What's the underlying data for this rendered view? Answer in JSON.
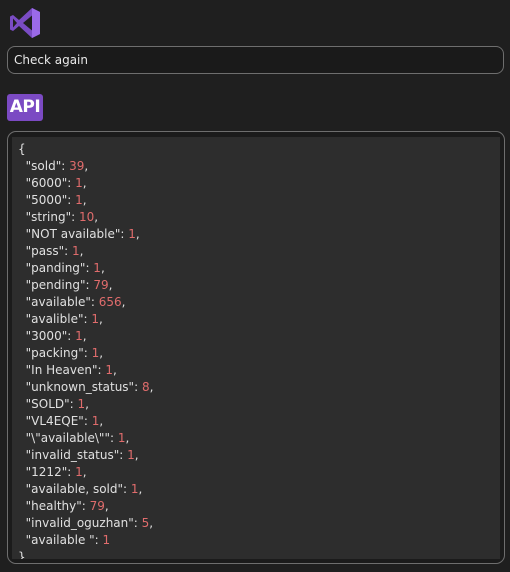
{
  "app": {
    "logo_icon": "visual-studio-logo-icon",
    "logo_color": "#8b5cd6"
  },
  "search": {
    "value": "Check again"
  },
  "api_badge": {
    "label": "API",
    "color": "#7b4ac3"
  },
  "json_view": {
    "open_brace": "{",
    "close_brace": "}",
    "entries": [
      {
        "key": "\"sold\"",
        "value": "39"
      },
      {
        "key": "\"6000\"",
        "value": "1"
      },
      {
        "key": "\"5000\"",
        "value": "1"
      },
      {
        "key": "\"string\"",
        "value": "10"
      },
      {
        "key": "\"NOT available\"",
        "value": "1"
      },
      {
        "key": "\"pass\"",
        "value": "1"
      },
      {
        "key": "\"panding\"",
        "value": "1"
      },
      {
        "key": "\"pending\"",
        "value": "79"
      },
      {
        "key": "\"available\"",
        "value": "656"
      },
      {
        "key": "\"avalible\"",
        "value": "1"
      },
      {
        "key": "\"3000\"",
        "value": "1"
      },
      {
        "key": "\"packing\"",
        "value": "1"
      },
      {
        "key": "\"In Heaven\"",
        "value": "1"
      },
      {
        "key": "\"unknown_status\"",
        "value": "8"
      },
      {
        "key": "\"SOLD\"",
        "value": "1"
      },
      {
        "key": "\"VL4EQE\"",
        "value": "1"
      },
      {
        "key": "\"\\\"available\\\"\"",
        "value": "1"
      },
      {
        "key": "\"invalid_status\"",
        "value": "1"
      },
      {
        "key": "\"1212\"",
        "value": "1"
      },
      {
        "key": "\"available, sold\"",
        "value": "1"
      },
      {
        "key": "\"healthy\"",
        "value": "79"
      },
      {
        "key": "\"invalid_oguzhan\"",
        "value": "5"
      },
      {
        "key": "\"available \"",
        "value": "1"
      }
    ],
    "key_color": "#e0e0e0",
    "number_color": "#e06c6c"
  }
}
